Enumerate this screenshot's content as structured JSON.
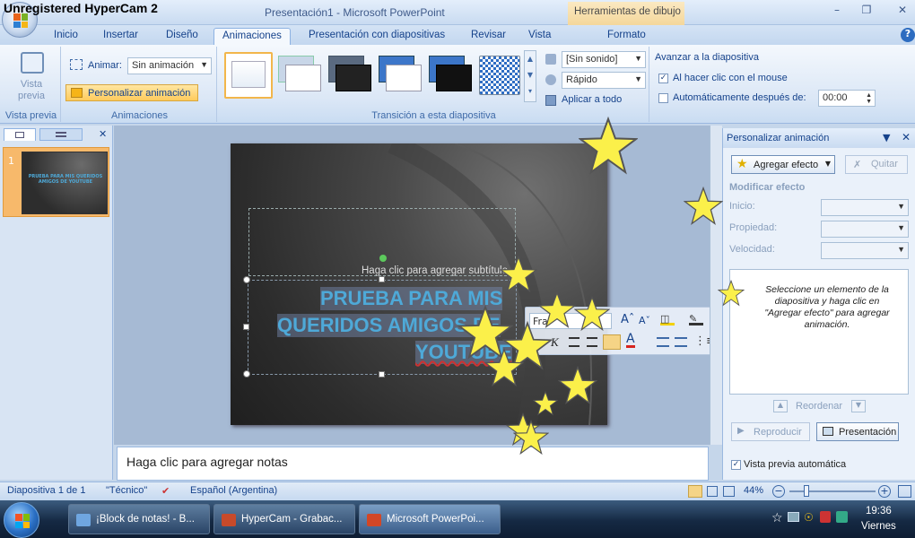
{
  "watermark": "Unregistered HyperCam 2",
  "window": {
    "title": "Presentación1 - Microsoft PowerPoint",
    "context_group": "Herramientas de dibujo"
  },
  "tabs": [
    "Inicio",
    "Insertar",
    "Diseño",
    "Animaciones",
    "Presentación con diapositivas",
    "Revisar",
    "Vista",
    "Formato"
  ],
  "ribbon": {
    "preview": {
      "label": "Vista previa",
      "group": "Vista previa"
    },
    "animations": {
      "animate_label": "Animar:",
      "animate_value": "Sin animación",
      "custom_button": "Personalizar animación",
      "group": "Animaciones"
    },
    "transition": {
      "sound_value": "[Sin sonido]",
      "speed_value": "Rápido",
      "apply_all": "Aplicar a todo",
      "group": "Transición a esta diapositiva"
    },
    "advance": {
      "title": "Avanzar a la diapositiva",
      "on_click": "Al hacer clic con el mouse",
      "auto_after": "Automáticamente después de:",
      "time": "00:00"
    }
  },
  "slides_pane": {
    "slide_number": "1",
    "thumb_text": "PRUEBA PARA MIS QUERIDOS AMIGOS DE YOUTUBE"
  },
  "slide": {
    "subtitle_placeholder": "Haga clic para agregar subtítulo",
    "title_line1": "PRUEBA PARA MIS",
    "title_line2": "QUERIDOS AMIGOS DE",
    "title_line3": "YOUTUBE"
  },
  "minitoolbar": {
    "font_fragment": "Fra"
  },
  "notes": {
    "placeholder": "Haga clic para agregar notas"
  },
  "task_pane": {
    "title": "Personalizar animación",
    "add_effect": "Agregar efecto",
    "remove": "Quitar",
    "modify": "Modificar efecto",
    "start": "Inicio:",
    "property": "Propiedad:",
    "speed": "Velocidad:",
    "hint": "Seleccione un elemento de la diapositiva y haga clic en \"Agregar efecto\" para agregar animación.",
    "reorder": "Reordenar",
    "play": "Reproducir",
    "slideshow": "Presentación",
    "auto_preview": "Vista previa automática"
  },
  "status": {
    "slide": "Diapositiva 1 de 1",
    "theme": "\"Técnico\"",
    "language": "Español (Argentina)",
    "zoom": "44%"
  },
  "taskbar": {
    "items": [
      "¡Block de notas! - B...",
      "HyperCam - Grabac...",
      "Microsoft PowerPoi..."
    ],
    "time": "19:36",
    "day": "Viernes"
  },
  "colors": {
    "accent": "#15428b",
    "title_text": "#4ea9d8",
    "star_fill": "#fbf04a"
  }
}
